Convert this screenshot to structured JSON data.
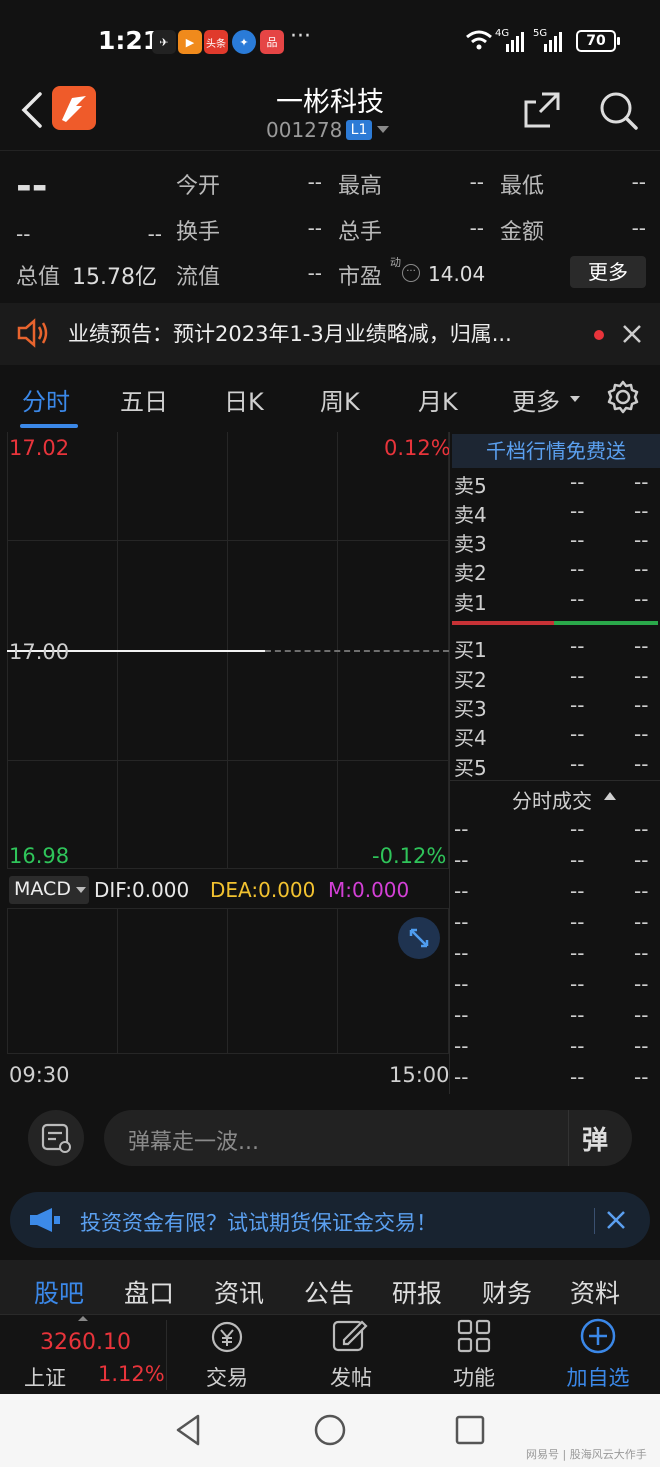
{
  "status_bar": {
    "time": "1:21",
    "app_icons": [
      {
        "name": "feishu-icon",
        "label": "✈",
        "color": "#222"
      },
      {
        "name": "video-app-icon",
        "label": "▶",
        "color": "#f08a1c"
      },
      {
        "name": "toutiao-icon",
        "label": "头条",
        "color": "#e03a2c"
      },
      {
        "name": "browser-icon",
        "label": "✦",
        "color": "#2a7bd8"
      },
      {
        "name": "red-app-icon",
        "label": "品",
        "color": "#e54545"
      }
    ],
    "more_dots": "···",
    "signal_1": "4G",
    "signal_2": "5G",
    "battery": "70"
  },
  "header": {
    "title": "一彬科技",
    "code": "001278",
    "level_badge": "L1"
  },
  "quote": {
    "price": "--",
    "change": "--",
    "change_pct": "--",
    "fields": [
      {
        "label": "今开",
        "value": "--"
      },
      {
        "label": "最高",
        "value": "--"
      },
      {
        "label": "最低",
        "value": "--"
      },
      {
        "label": "换手",
        "value": "--"
      },
      {
        "label": "总手",
        "value": "--"
      },
      {
        "label": "金额",
        "value": "--"
      }
    ],
    "market_cap_label": "总值",
    "market_cap_value": "15.78亿",
    "float_label": "流值",
    "float_value": "--",
    "pe_label": "市盈",
    "pe_sup": "动",
    "pe_value": "14.04",
    "more_button": "更多"
  },
  "notice": {
    "text": "业绩预告：预计2023年1-3月业绩略减，归属..."
  },
  "chart_tabs": [
    "分时",
    "五日",
    "日K",
    "周K",
    "月K",
    "更多"
  ],
  "chart": {
    "top_price": "17.02",
    "top_pct": "0.12%",
    "mid_price": "17.00",
    "bottom_price": "16.98",
    "bottom_pct": "-0.12%",
    "macd_selector": "MACD",
    "dif": "DIF:0.000",
    "dea": "DEA:0.000",
    "m": "M:0.000",
    "time_start": "09:30",
    "time_end": "15:00"
  },
  "order_book": {
    "title": "千档行情免费送",
    "asks": [
      {
        "label": "卖5",
        "price": "--",
        "vol": "--"
      },
      {
        "label": "卖4",
        "price": "--",
        "vol": "--"
      },
      {
        "label": "卖3",
        "price": "--",
        "vol": "--"
      },
      {
        "label": "卖2",
        "price": "--",
        "vol": "--"
      },
      {
        "label": "卖1",
        "price": "--",
        "vol": "--"
      }
    ],
    "bids": [
      {
        "label": "买1",
        "price": "--",
        "vol": "--"
      },
      {
        "label": "买2",
        "price": "--",
        "vol": "--"
      },
      {
        "label": "买3",
        "price": "--",
        "vol": "--"
      },
      {
        "label": "买4",
        "price": "--",
        "vol": "--"
      },
      {
        "label": "买5",
        "price": "--",
        "vol": "--"
      }
    ],
    "ticks_title": "分时成交",
    "ticks": [
      {
        "t": "--",
        "p": "--",
        "v": "--"
      },
      {
        "t": "--",
        "p": "--",
        "v": "--"
      },
      {
        "t": "--",
        "p": "--",
        "v": "--"
      },
      {
        "t": "--",
        "p": "--",
        "v": "--"
      },
      {
        "t": "--",
        "p": "--",
        "v": "--"
      },
      {
        "t": "--",
        "p": "--",
        "v": "--"
      },
      {
        "t": "--",
        "p": "--",
        "v": "--"
      },
      {
        "t": "--",
        "p": "--",
        "v": "--"
      },
      {
        "t": "--",
        "p": "--",
        "v": "--"
      }
    ]
  },
  "danmu": {
    "placeholder": "弹幕走一波...",
    "toggle_label": "弹"
  },
  "banner": {
    "text": "投资资金有限？试试期货保证金交易！"
  },
  "bottom_tabs": [
    "股吧",
    "盘口",
    "资讯",
    "公告",
    "研报",
    "财务",
    "资料"
  ],
  "toolbar": {
    "index_value": "3260.10",
    "index_name": "上证",
    "index_pct": "1.12%",
    "items": [
      "交易",
      "发帖",
      "功能",
      "加自选"
    ]
  },
  "watermark": "网易号 | 股海风云大作手",
  "colors": {
    "up": "#e8343b",
    "down": "#2fc45a",
    "accent": "#3b88e8"
  }
}
